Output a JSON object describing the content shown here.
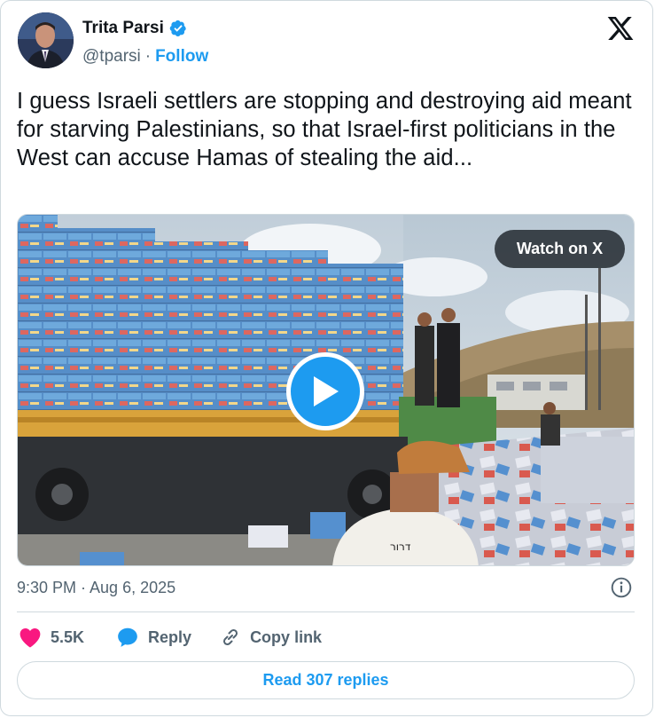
{
  "author": {
    "name": "Trita Parsi",
    "handle": "@tparsi",
    "separator": "·",
    "follow_label": "Follow",
    "verified": true
  },
  "tweet": {
    "text": "I guess Israeli settlers are stopping and destroying aid meant for starving Palestinians, so that Israel-first politicians in the West can accuse Hamas of stealing the aid...",
    "timestamp": "9:30 PM · Aug 6, 2025"
  },
  "media": {
    "type": "video",
    "watch_label": "Watch on X",
    "overlay_text": "דרור"
  },
  "actions": {
    "likes": "5.5K",
    "reply_label": "Reply",
    "copy_link_label": "Copy link"
  },
  "read_replies_label": "Read 307 replies",
  "colors": {
    "accent": "#1d9bf0",
    "like": "#f91880",
    "text_primary": "#0f1419",
    "text_secondary": "#536471",
    "border": "#cfd9de"
  },
  "icons": [
    "verified-badge-icon",
    "x-logo-icon",
    "play-icon",
    "info-icon",
    "heart-icon",
    "reply-bubble-icon",
    "link-icon"
  ]
}
